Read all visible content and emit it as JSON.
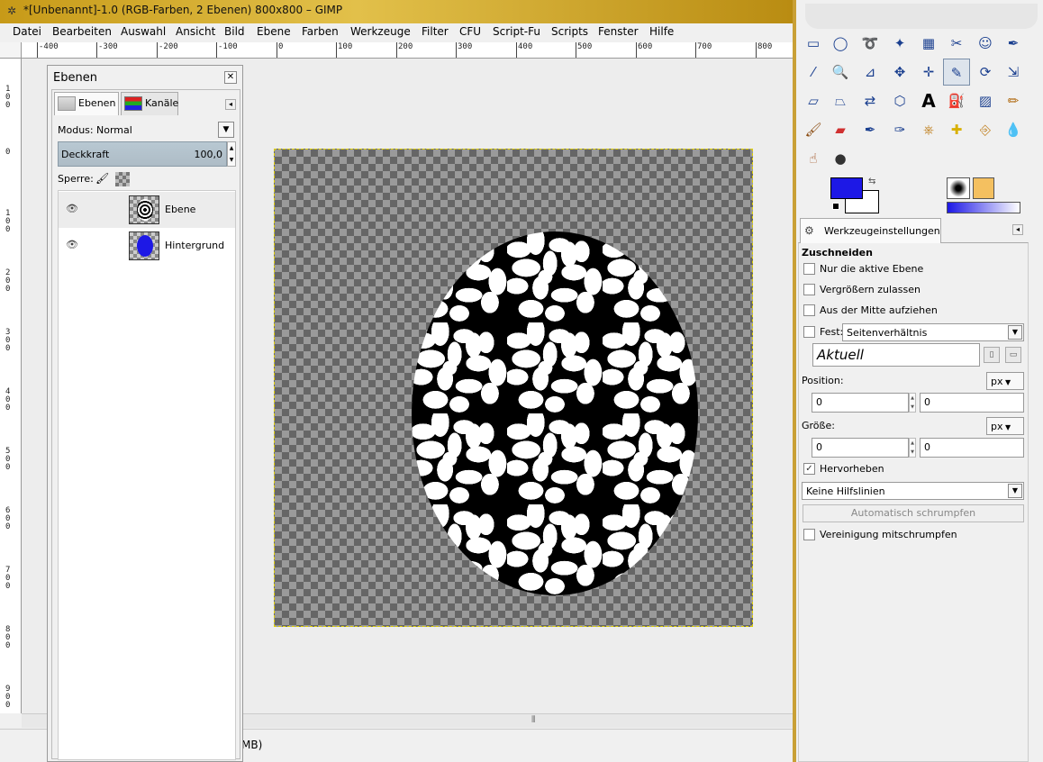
{
  "window": {
    "title": "*[Unbenannt]-1.0 (RGB-Farben, 2 Ebenen) 800x800 – GIMP"
  },
  "menu": [
    "Datei",
    "Bearbeiten",
    "Auswahl",
    "Ansicht",
    "Bild",
    "Ebene",
    "Farben",
    "Werkzeuge",
    "Filter",
    "CFU",
    "Script-Fu",
    "Scripts",
    "Fenster",
    "Hilfe"
  ],
  "ruler": {
    "h_labels": [
      "-400",
      "-300",
      "-200",
      "-100",
      "0",
      "100",
      "200",
      "300",
      "400",
      "500",
      "600",
      "700",
      "800"
    ],
    "v_labels": [
      "1",
      "0",
      "0",
      "0",
      "1",
      "0",
      "0",
      "2",
      "0",
      "0",
      "3",
      "0",
      "0",
      "4",
      "0",
      "0",
      "5",
      "0",
      "0",
      "6",
      "0",
      "0",
      "7",
      "0",
      "0",
      "8",
      "0",
      "0",
      "9",
      "0",
      "0"
    ]
  },
  "status": {
    "text": "MB)"
  },
  "layers_dock": {
    "title": "Ebenen",
    "tabs": [
      "Ebenen",
      "Kanäle"
    ],
    "mode_label": "Modus:",
    "mode_value": "Normal",
    "opacity_label": "Deckkraft",
    "opacity_value": "100,0",
    "lock_label": "Sperre:",
    "layers": [
      {
        "name": "Ebene",
        "selected": true,
        "thumb": "noise-blob"
      },
      {
        "name": "Hintergrund",
        "selected": false,
        "thumb": "blue-ellipse"
      }
    ]
  },
  "toolbox": {
    "tools": [
      "rect-select",
      "ellipse-select",
      "free-select",
      "fuzzy-select",
      "select-by-color",
      "scissors",
      "foreground-select",
      "paths",
      "color-picker",
      "zoom",
      "measure",
      "move",
      "align",
      "crop",
      "rotate",
      "scale",
      "shear",
      "perspective",
      "flip",
      "cage",
      "text",
      "blend-tool",
      "gradient",
      "pencil",
      "paintbrush",
      "eraser",
      "airbrush",
      "ink",
      "clone",
      "heal",
      "perspective-clone",
      "blur",
      "smudge",
      "dodge-burn"
    ],
    "selected_tool": "crop",
    "fg_color": "#1d18e6",
    "bg_color": "#ffffff"
  },
  "tool_options": {
    "tab_label": "Werkzeugeinstellungen",
    "heading": "Zuschneiden",
    "cb_active_layer": {
      "label": "Nur die aktive Ebene",
      "checked": false
    },
    "cb_allow_grow": {
      "label": "Vergrößern zulassen",
      "checked": false
    },
    "cb_from_center": {
      "label": "Aus der Mitte aufziehen",
      "checked": false
    },
    "cb_fixed": {
      "label": "Fest:",
      "checked": false
    },
    "fixed_dropdown": "Seitenverhältnis",
    "aktuell": "Aktuell",
    "position_label": "Position:",
    "position_unit": "px",
    "position_x": "0",
    "position_y": "0",
    "size_label": "Größe:",
    "size_unit": "px",
    "size_w": "0",
    "size_h": "0",
    "cb_highlight": {
      "label": "Hervorheben",
      "checked": true
    },
    "guides_dropdown": "Keine Hilfslinien",
    "autoshrink_button": "Automatisch schrumpfen",
    "cb_merge_shrink": {
      "label": "Vereinigung mitschrumpfen",
      "checked": false
    }
  }
}
